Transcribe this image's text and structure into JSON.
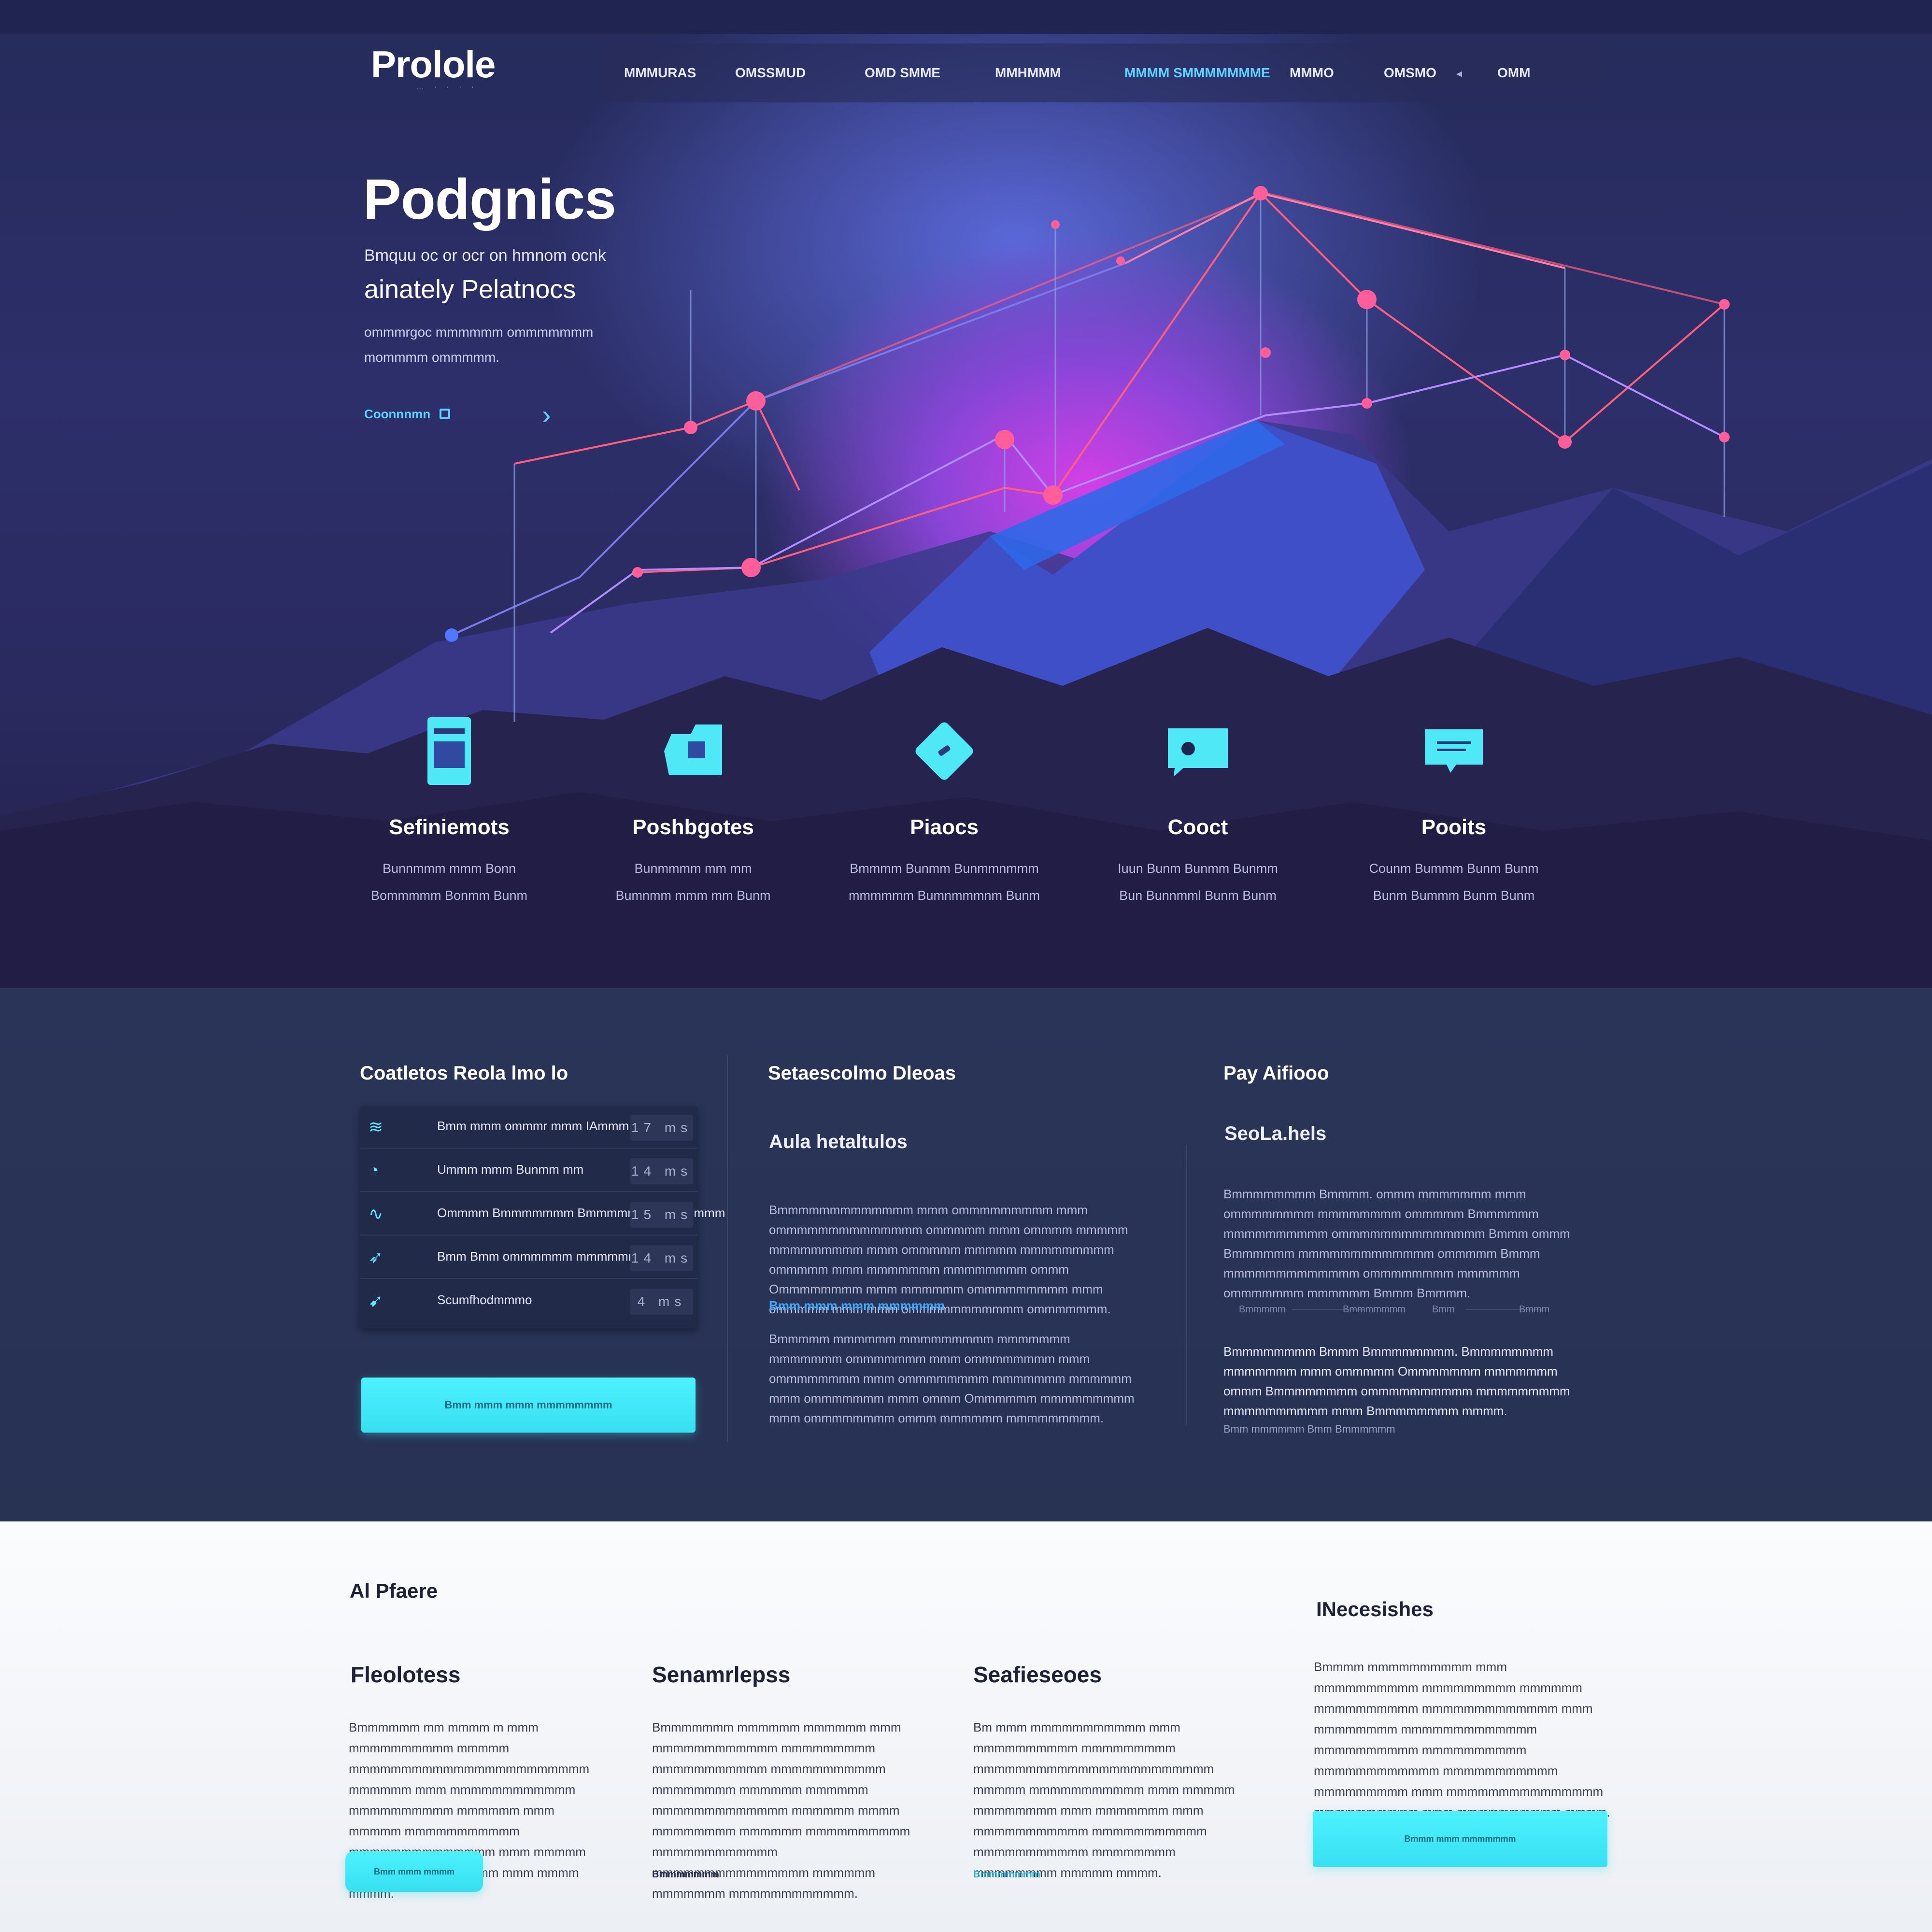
{
  "brand": {
    "logo": "Prolole",
    "tagline": "… · · · ·"
  },
  "nav": {
    "items": [
      {
        "label": "MMMURAS",
        "active": false
      },
      {
        "label": "OMSSMUD",
        "active": false
      },
      {
        "label": "OMD SMME",
        "active": false
      },
      {
        "label": "MMHMMM",
        "active": false
      },
      {
        "label": "MMMM SMMMMMMME",
        "active": true
      },
      {
        "label": "MMMO",
        "active": false
      },
      {
        "label": "OMSMO",
        "active": false
      },
      {
        "label": "OMM",
        "active": false
      }
    ]
  },
  "hero": {
    "title": "Podgnics",
    "line1": "Bmquu oc or ocr on hmnom ocnk",
    "line2": "ainately Pelatnocs",
    "description": "ommmrgoc mmmmmm ommmmmmm mommmm ommmmm.",
    "cta_label": "Coonnnmn",
    "cta_arrow": "›"
  },
  "features": [
    {
      "icon": "document-icon",
      "title": "Sefiniemots",
      "desc1": "Bunnmmm mmm Bonn",
      "desc2": "Bommmmm Bonmm Bunm"
    },
    {
      "icon": "folder-icon",
      "title": "Poshbgotes",
      "desc1": "Bunmmmm mm mm",
      "desc2": "Bumnmm mmm mm Bunm"
    },
    {
      "icon": "diamond-icon",
      "title": "Piaocs",
      "desc1": "Bmmmm Bunmm Bunmmnmmm",
      "desc2": "mmmmmm Bumnmmmnm Bunm"
    },
    {
      "icon": "chat-icon",
      "title": "Cooct",
      "desc1": "Iuun Bunm Bunmm Bunmm",
      "desc2": "Bun Bunnmml Bunm Bunm"
    },
    {
      "icon": "message-icon",
      "title": "Pooits",
      "desc1": "Counm Bummm Bunm Bunm",
      "desc2": "Bunm Bummm Bunm Bunm"
    }
  ],
  "dark": {
    "col1": {
      "heading": "Coatletos Reola lmo lo",
      "rows": [
        {
          "icon": "signal-icon",
          "label": "Bmm mmm ommmr mmm IAmmm",
          "value": "17 ms"
        },
        {
          "icon": "gauge-icon",
          "label": "Ummm mmm Bunmm mm",
          "value": "14 ms"
        },
        {
          "icon": "wave-icon",
          "label": "Ommmm Bmmmmmmm Bmmmmmmmmm mmmm",
          "value": "15 ms"
        },
        {
          "icon": "plane-icon",
          "label": "Bmm Bmm ommmmmm mmmmmmmm",
          "value": "14 ms"
        },
        {
          "icon": "rocket-icon",
          "label": "Scumfhodmmmo",
          "value": "4 ms"
        }
      ],
      "button_label": "Bmm mmm mmm mmmmmmmm"
    },
    "col2": {
      "heading": "Setaescolmo Dleoas",
      "subheading": "Aula hetaltulos",
      "para1": "Bmmmmmmmmmmmmm mmm ommmmmmmmm mmm ommmmmmmmmmmmmm ommmmm mmm ommmm mmmmm mmmmmmmmm mmm ommmmm mmmmm mmmmmmmmm ommmmm mmm mmmmmmm mmmmmmmm ommm Ommmmmmmm mmm mmmmmm ommmmmmmmm mmm ommmmm mmm mmm ommmmmmmmmmm ommmmmmm.",
      "link": "Bmm mmm mmm mmmmmm",
      "para2": "Bmmmmm mmmmmm mmmmmmmmm mmmmmmm mmmmmmm ommmmmmm mmm ommmmmmmm mmm ommmmmmmm mmm ommmmmmmm mmmmmmm mmmmmm mmm ommmmmmm mmm ommm Ommmmmm mmmmmmmmm mmm ommmmmmmm ommm mmmmmm mmmmmmmmm."
    },
    "col3": {
      "heading": "Pay Aifiooo",
      "subheading": "SeoLa.hels",
      "para1": "Bmmmmmmmm Bmmmm. ommm mmmmmmm mmm ommmmmmmm mmmmmmmm ommmmm Bmmmmmm mmmmmmmmmm ommmmmmmmmmmmmm Bmmm ommm Bmmmmmm mmmmmmmmmmmmm ommmmm Bmmm mmmmmmmmmmmmm ommmmmmmm mmmmmm ommmmmmm mmmmmm Bmmm Bmmmm.",
      "tabs": [
        "Bmmmmm",
        "Bmmmmmmm",
        "Bmm",
        "Bmmm"
      ],
      "para2": "Bmmmmmmmm Bmmm Bmmmmmmmm. Bmmmmmmmm mmmmmmm mmm ommmmm Ommmmmmm mmmmmmm ommm Bmmmmmmmm ommmmmmmmmm mmmmmmmmm mmmmmmmmmm mmm Bmmmmmmmm mmmm.",
      "footnote": "Bmm mmmmmm Bmm Bmmmmmm"
    }
  },
  "light": {
    "section_title": "Al Pfaere",
    "side_title": "INecesishes",
    "columns": [
      {
        "title": "Fleolotess",
        "body": "Bmmmmmm mm mmmm m mmm mmmmmmmmmm mmmmm mmmmmmmmmmmmmmmmmmmmmmm mmmmmm mmm mmmmmmmmmmmm mmmmmmmmmm mmmmmm mmm mmmmm mmmmmmmmmmm mmmmmmmmmmmmmm mmm mmmmm mmmmmmm mmmmmmm mmm mmmm mmmm."
      },
      {
        "title": "Senamrlepss",
        "body": "Bmmmmmmm mmmmmm mmmmmm mmm mmmmmmmmmmmm mmmmmmmmm mmmmmmmmmmm mmmmmmmmmmm mmmmmmmm mmmmmm mmmmmm mmmmmmmmmmmmm mmmmmm mmmm mmmmmmmm mmmmmm mmmmmmmmmm mmmmmmmmmmmm mmmmmmmmmmmmmmm mmmmmm mmmmmmm mmmmmmmmmmmm."
      },
      {
        "title": "Seafieseoes",
        "body": "Bm mmm mmmmmmmmmmm mmm mmmmmmmmmm mmmmmmmmm mmmmmmmmmmmmmmmmmmmmmmm mmmmm mmmmmmmmmmm mmm mmmmm mmmmmmmm mmm mmmmmmm mmm mmmmmmmmmmm mmmmmmmmmmm mmmmmmmmmmm mmmmmmmm mmmmmmmm mmmmm mmmm."
      }
    ],
    "left_button_label": "Bmm mmm mmmm",
    "col2_link": "Bmmmmmmm",
    "col3_link": "Bmmmmmmm",
    "side_body": "Bmmmm mmmmmmmmmm mmm mmmmmmmmmm mmmmmmmmm mmmmmm mmmmmmmmmm mmmmmmmmmmmmm mmm mmmmmmmm mmmmmmmmmmmmm mmmmmmmmmm mmmmmmmmmm mmmmmmmmmmmm mmmmmmmmmmm mmmmmmmmm mmm mmmmmmmmmmmmmmm mmmmmmmmmm mmm mmmmmmmmmm mmmm.",
    "side_button_label": "Bmmm mmm mmmmmmm"
  }
}
